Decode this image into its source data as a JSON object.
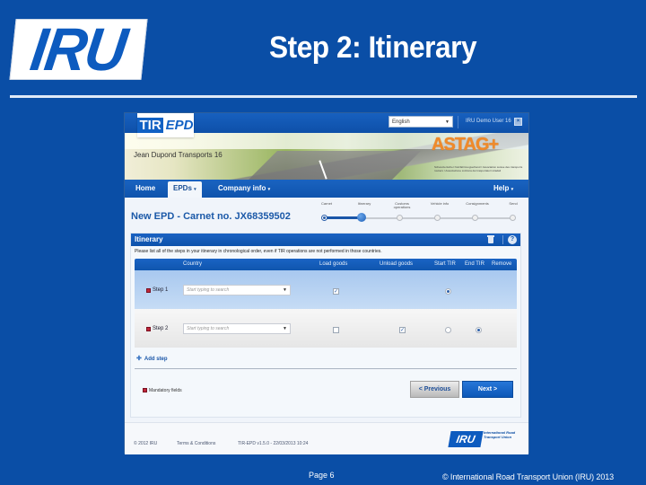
{
  "slide": {
    "logo": "IRU",
    "title": "Step 2: Itinerary",
    "page_label": "Page 6",
    "copyright": "© International Road Transport Union (IRU) 2013"
  },
  "app": {
    "logo_tir": "TIR",
    "logo_epd": "EPD",
    "language": {
      "selected": "English"
    },
    "user": "IRU Demo User 16",
    "company": "Jean Dupond Transports 16",
    "partner_logo": "ASTAG+",
    "partner_subtitle": "Schweizerischer Nutzfahrzeugverband / Association suisse des transports routiers / Associazione svizzera dei trasportatori stradali",
    "nav": {
      "items": [
        {
          "label": "Home",
          "dropdown": false,
          "active": false
        },
        {
          "label": "EPDs",
          "dropdown": true,
          "active": true
        },
        {
          "label": "Company info",
          "dropdown": true,
          "active": false
        },
        {
          "label": "Help",
          "dropdown": true,
          "active": false
        }
      ],
      "caret": "▾"
    },
    "page_heading": "New EPD - Carnet no. JX68359502",
    "wizard": {
      "current_step": 2,
      "total_steps": 6,
      "steps": [
        {
          "label": "Carnet",
          "state": "done"
        },
        {
          "label": "Itinerary",
          "state": "current"
        },
        {
          "label": "Customs operations",
          "state": "todo"
        },
        {
          "label": "Vehicle info",
          "state": "todo"
        },
        {
          "label": "Consignments",
          "state": "todo"
        },
        {
          "label": "Send",
          "state": "todo"
        }
      ]
    },
    "panel": {
      "title": "Itinerary",
      "instructions": "Please list all of the steps in your itinerary in chronological order, even if TIR operations are not performed in those countries.",
      "help_glyph": "?",
      "columns": [
        "Country",
        "Load goods",
        "Unload goods",
        "Start TIR",
        "End TIR",
        "Remove"
      ],
      "rows": [
        {
          "label": "Step 1",
          "country_placeholder": "Start typing to search",
          "load_goods": true,
          "unload_goods": null,
          "start_tir": true,
          "end_tir": null,
          "selected": true
        },
        {
          "label": "Step 2",
          "country_placeholder": "Start typing to search",
          "load_goods": false,
          "unload_goods": true,
          "start_tir": false,
          "end_tir": true,
          "selected": false
        }
      ],
      "add_step": "Add step",
      "mandatory_note": "Mandatory fields",
      "previous_button": "< Previous",
      "next_button": "Next >"
    },
    "footer": {
      "copyright": "© 2012 IRU",
      "terms": "Terms & Conditions",
      "version": "TIR-EPD v1.5.0 - 22/03/2013 10:24",
      "iru_logo": "IRU",
      "iru_text": "International Road Transport Union"
    }
  }
}
